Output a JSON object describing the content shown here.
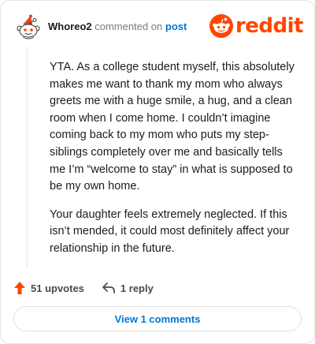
{
  "header": {
    "username": "Whoreo2",
    "action_text": "commented on",
    "post_link": "post",
    "logo_text": "reddit"
  },
  "comment": {
    "paragraphs": [
      "YTA. As a college student myself, this absolutely makes me want to thank my mom who always greets me with a huge smile, a hug, and a clean room when I come home. I couldn’t imagine coming back to my mom who puts my step-siblings completely over me and basically tells me I’m “welcome to stay” in what is supposed to be my own home.",
      "Your daughter feels extremely neglected. If this isn’t mended, it could most definitely affect your relationship in the future."
    ]
  },
  "actions": {
    "upvotes": "51 upvotes",
    "reply": "1 reply"
  },
  "view_button": {
    "label": "View 1 comments"
  },
  "colors": {
    "brand": "#ff4500",
    "link": "#0079d3",
    "text": "#1a1a1b",
    "muted": "#7c7c7c"
  },
  "icons": [
    "snoo-avatar-icon",
    "snoo-logo-icon",
    "upvote-arrow-icon",
    "reply-arrow-icon"
  ]
}
